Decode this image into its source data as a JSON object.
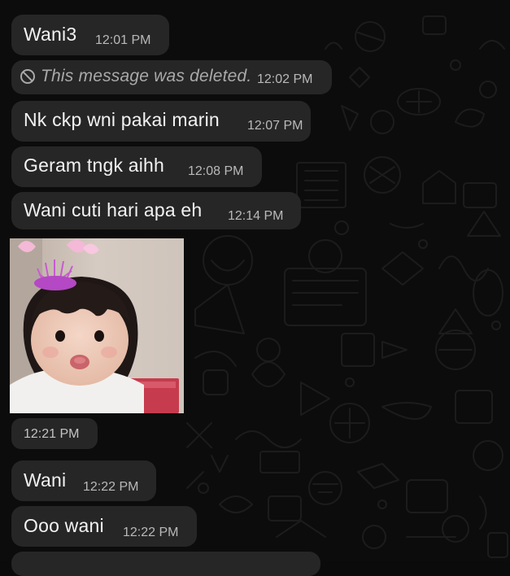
{
  "messages": [
    {
      "text": "Wani3",
      "time": "12:01 PM"
    },
    {
      "text": "This message was deleted.",
      "time": "12:02 PM",
      "deleted": true
    },
    {
      "text": "Nk ckp wni pakai marin",
      "time": "12:07 PM"
    },
    {
      "text": "Geram tngk aihh",
      "time": "12:08 PM"
    },
    {
      "text": "Wani cuti hari apa eh",
      "time": "12:14 PM"
    },
    {
      "image": "photo-child-tinsel-headband",
      "time": "12:21 PM"
    },
    {
      "text": "Wani",
      "time": "12:22 PM"
    },
    {
      "text": "Ooo wani",
      "time": "12:22 PM"
    }
  ],
  "colors": {
    "background": "#0c0c0c",
    "bubble": "#262626",
    "text": "#f2f2f2",
    "timestamp": "#b9b9b9",
    "deleted_text": "#a9a9a9"
  },
  "icons": {
    "deleted": "ban-icon"
  }
}
